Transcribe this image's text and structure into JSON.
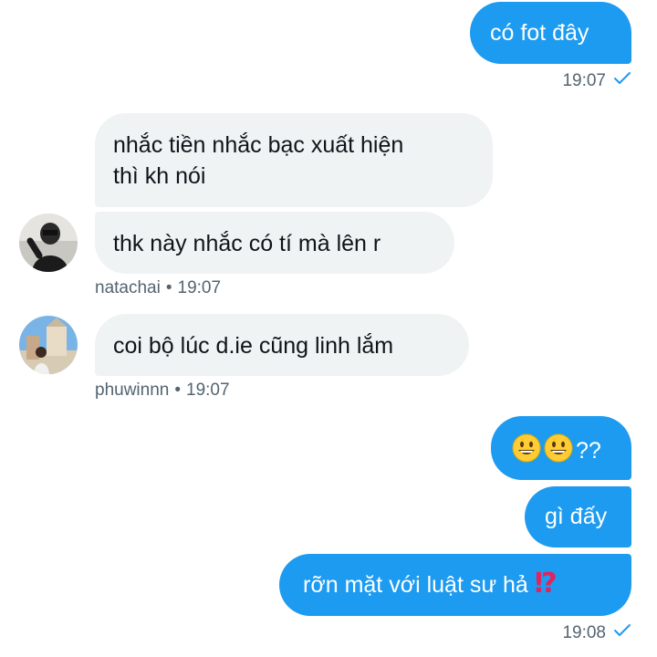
{
  "messages": [
    {
      "text": "có fot đây"
    },
    {
      "text": "nhắc tiền nhắc bạc xuất hiện thì kh nói",
      "line1": "nhắc tiền nhắc bạc xuất hiện",
      "line2": "thì kh nói"
    },
    {
      "text": "thk này nhắc có tí mà lên r"
    },
    {
      "text": "coi bộ lúc d.ie cũng linh lắm"
    },
    {
      "text": "??",
      "emoji": [
        "grinning-face-emoji",
        "grinning-face-emoji"
      ]
    },
    {
      "text": "gì đấy"
    },
    {
      "text": "rỡn mặt với luật sư hả",
      "emoji_suffix": "⁉"
    }
  ],
  "meta": {
    "sent_time_1": "19:07",
    "sender1": "natachai",
    "sender1_time": "19:07",
    "sender2": "phuwinnn",
    "sender2_time": "19:07",
    "sent_time_2": "19:08",
    "separator": "•"
  },
  "icons": {
    "read_receipt": "check-icon",
    "emoji": "grinning-face-emoji",
    "exclamation": "exclamation-question-emoji"
  },
  "colors": {
    "outgoing_bubble": "#1d9bf0",
    "incoming_bubble": "#eff3f4",
    "meta_text": "#536471"
  }
}
